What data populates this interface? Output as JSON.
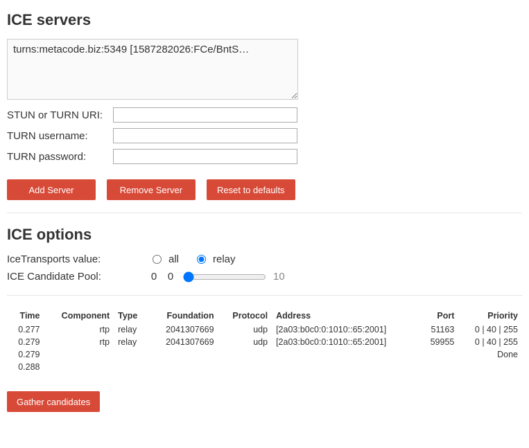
{
  "servers": {
    "heading": "ICE servers",
    "textarea_value": "turns:metacode.biz:5349 [1587282026:FCe/BntS…",
    "stun_label": "STUN or TURN URI:",
    "stun_value": "",
    "turn_user_label": "TURN username:",
    "turn_user_value": "",
    "turn_pass_label": "TURN password:",
    "turn_pass_value": "",
    "add_btn": "Add Server",
    "remove_btn": "Remove Server",
    "reset_btn": "Reset to defaults"
  },
  "options": {
    "heading": "ICE options",
    "transports_label": "IceTransports value:",
    "radio_all": "all",
    "radio_relay": "relay",
    "selected": "relay",
    "pool_label": "ICE Candidate Pool:",
    "pool_lo": "0",
    "pool_val": "0",
    "pool_hi": "10"
  },
  "table": {
    "headers": {
      "time": "Time",
      "component": "Component",
      "type": "Type",
      "foundation": "Foundation",
      "protocol": "Protocol",
      "address": "Address",
      "port": "Port",
      "priority": "Priority"
    },
    "rows": [
      {
        "time": "0.277",
        "component": "rtp",
        "type": "relay",
        "foundation": "2041307669",
        "protocol": "udp",
        "address": "[2a03:b0c0:0:1010::65:2001]",
        "port": "51163",
        "priority": "0 | 40 | 255"
      },
      {
        "time": "0.279",
        "component": "rtp",
        "type": "relay",
        "foundation": "2041307669",
        "protocol": "udp",
        "address": "[2a03:b0c0:0:1010::65:2001]",
        "port": "59955",
        "priority": "0 | 40 | 255"
      },
      {
        "time": "0.279",
        "component": "",
        "type": "",
        "foundation": "",
        "protocol": "",
        "address": "",
        "port": "",
        "priority": "Done"
      },
      {
        "time": "0.288",
        "component": "",
        "type": "",
        "foundation": "",
        "protocol": "",
        "address": "",
        "port": "",
        "priority": ""
      }
    ]
  },
  "gather_btn": "Gather candidates"
}
